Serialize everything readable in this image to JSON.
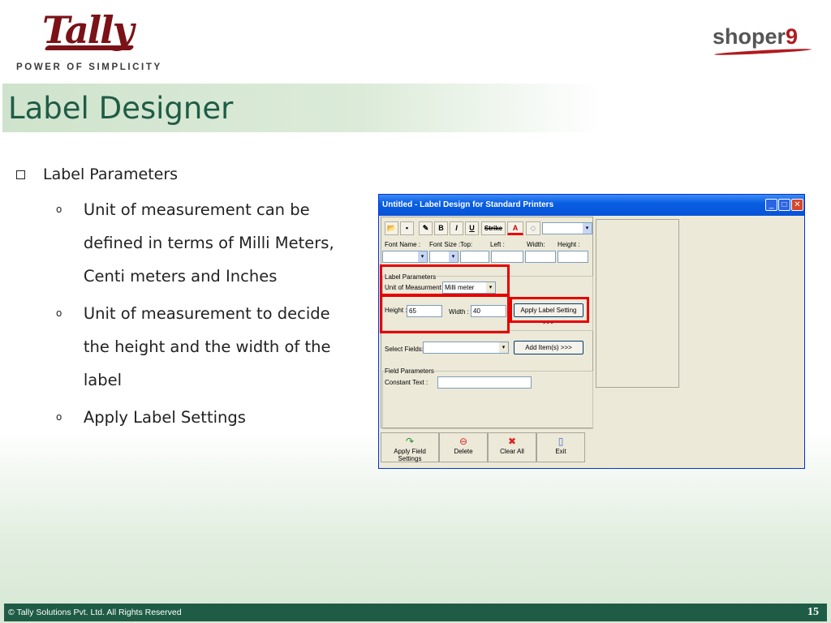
{
  "header": {
    "brand_logo": "Tally",
    "brand_tagline": "POWER OF SIMPLICITY",
    "partner_logo_text": "shoper",
    "partner_logo_num": "9"
  },
  "page_title": "Label Designer",
  "bullets": {
    "heading": "Label Parameters",
    "items": [
      "Unit of measurement can be defined in terms of Milli Meters, Centi meters and Inches",
      "Unit of measurement to decide the height and the width of the label",
      "Apply Label Settings"
    ],
    "lines": [
      [
        "Unit of measurement can be",
        "defined in terms of Milli Meters,",
        "Centi meters and Inches"
      ],
      [
        "Unit of measurement to decide",
        "the height and the width of the",
        "label"
      ],
      [
        "Apply Label Settings"
      ]
    ]
  },
  "window": {
    "title": "Untitled - Label Design for Standard Printers",
    "toolbar": {
      "bold": "B",
      "italic": "I",
      "underline": "U",
      "strike": "Strike",
      "font_color": "A"
    },
    "font_row": {
      "font_name_label": "Font Name :",
      "font_size_label": "Font Size :",
      "top_label": "Top:",
      "left_label": "Left :",
      "width_label": "Width:",
      "height_label": "Height :"
    },
    "label_params": {
      "group_label": "Label Parameters",
      "unit_label": "Unit of Measurment :",
      "unit_value": "Milli meter",
      "height_label": "Height :",
      "height_value": "65",
      "width_label": "Width :",
      "width_value": "40",
      "apply_button": "Apply Label Setting >>>"
    },
    "select_fields": {
      "label": "Select Fields:",
      "add_button": "Add Item(s) >>>"
    },
    "field_params": {
      "group_label": "Field Parameters",
      "constant_text_label": "Constant Text :",
      "constant_text_value": ""
    },
    "bottom_buttons": {
      "apply_field": "Apply Field Settings",
      "delete": "Delete",
      "clear_all": "Clear All",
      "exit": "Exit"
    }
  },
  "footer": {
    "copyright": "© Tally Solutions Pvt. Ltd. All Rights Reserved",
    "page_number": "15"
  },
  "colors": {
    "brand_green": "#1f5c46",
    "tally_red": "#7a1218",
    "highlight_red": "#e60000"
  }
}
